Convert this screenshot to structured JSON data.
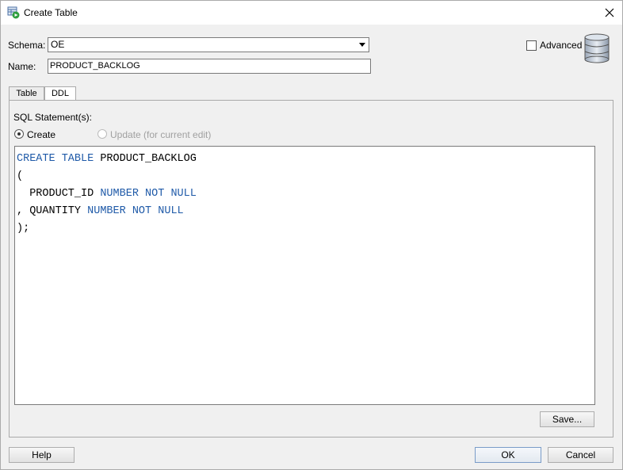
{
  "window": {
    "title": "Create Table",
    "icons": {
      "app": "create-table-icon",
      "close": "close-icon"
    }
  },
  "form": {
    "schema_label": "Schema:",
    "schema_value": "OE",
    "name_label": "Name:",
    "name_value": "PRODUCT_BACKLOG",
    "advanced_label": "Advanced",
    "advanced_checked": false
  },
  "tabs": [
    {
      "label": "Table",
      "active": false
    },
    {
      "label": "DDL",
      "active": true
    }
  ],
  "ddl": {
    "statements_label": "SQL Statement(s):",
    "create_radio_label": "Create",
    "update_radio_label": "Update (for current edit)",
    "code_lines": [
      [
        {
          "t": "CREATE TABLE",
          "kw": true
        },
        {
          "t": " PRODUCT_BACKLOG",
          "kw": false
        }
      ],
      [
        {
          "t": "(",
          "kw": false
        }
      ],
      [
        {
          "t": "  PRODUCT_ID ",
          "kw": false
        },
        {
          "t": "NUMBER NOT NULL",
          "kw": true
        }
      ],
      [
        {
          "t": ", QUANTITY ",
          "kw": false
        },
        {
          "t": "NUMBER NOT NULL",
          "kw": true
        }
      ],
      [
        {
          "t": ");",
          "kw": false
        }
      ]
    ],
    "save_label": "Save..."
  },
  "footer": {
    "help_label": "Help",
    "ok_label": "OK",
    "cancel_label": "Cancel"
  },
  "colors": {
    "keyword": "#1f5aa8",
    "background": "#f0f0f0"
  }
}
